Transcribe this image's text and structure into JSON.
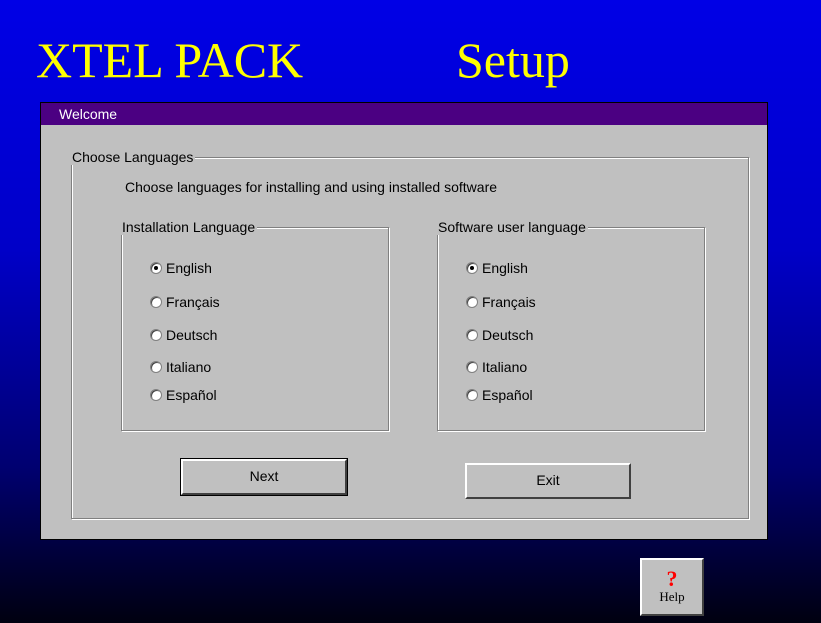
{
  "header": {
    "title_left": "XTEL PACK",
    "title_right": "Setup"
  },
  "dialog": {
    "title": "Welcome",
    "group_title": "Choose Languages",
    "subtitle": "Choose languages for installing and using installed software",
    "installation": {
      "title": "Installation Language",
      "options": [
        "English",
        "Français",
        "Deutsch",
        "Italiano",
        "Español"
      ],
      "selected": "English"
    },
    "user": {
      "title": "Software user language",
      "options": [
        "English",
        "Français",
        "Deutsch",
        "Italiano",
        "Español"
      ],
      "selected": "English"
    },
    "buttons": {
      "next": "Next",
      "exit": "Exit"
    }
  },
  "help": {
    "icon": "?",
    "label": "Help"
  },
  "colors": {
    "title_text": "#ffff00",
    "titlebar": "#4b0082",
    "dialog_bg": "#c0c0c0",
    "help_icon": "#ff0000"
  }
}
